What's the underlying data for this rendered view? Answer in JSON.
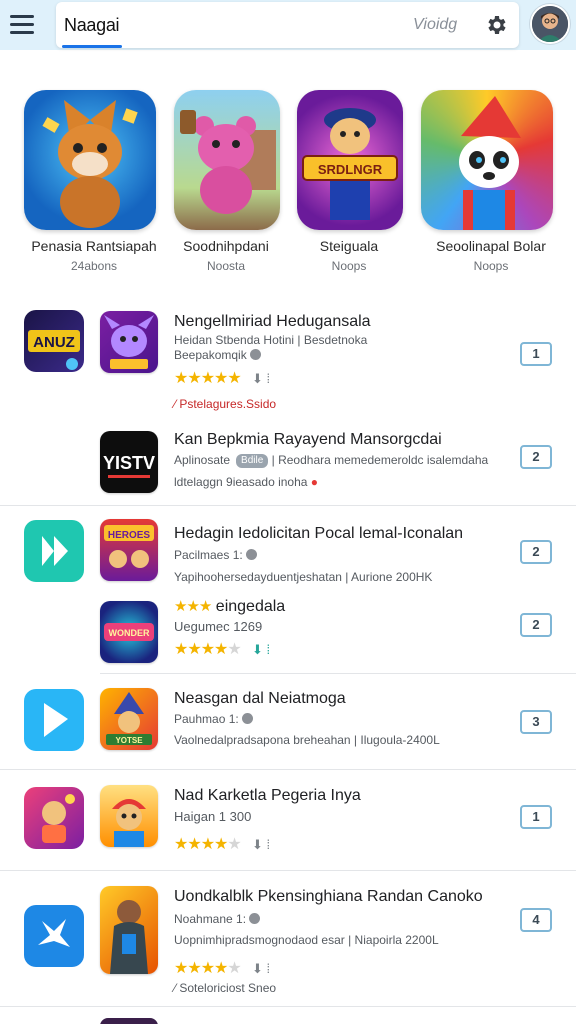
{
  "header": {
    "search_value": "Naagai",
    "search_hint": "Vioidg",
    "menu_icon": "hamburger-menu-icon",
    "settings_icon": "gear-icon",
    "avatar_icon": "user-avatar"
  },
  "featured": [
    {
      "title": "Penasia Rantsiapah",
      "subtitle": "24abons",
      "icon": "fox-hero-game-icon"
    },
    {
      "title": "Soodnihpdani",
      "subtitle": "Noosta",
      "icon": "pink-bear-game-icon"
    },
    {
      "title": "Steiguala",
      "subtitle": "Noops",
      "icon": "pirate-runner-game-icon",
      "badge_text": "SRDLNGR"
    },
    {
      "title": "Seoolinapal Bolar",
      "subtitle": "Noops",
      "icon": "panda-wizard-game-icon"
    }
  ],
  "list": [
    {
      "group_icon": "rushy-logo-icon",
      "group_icon_text": "ANUZ",
      "rows": [
        {
          "title": "Nengellmiriad Hedugansala",
          "line1": "Heidan Stbenda Hotini | Besdetnoka",
          "line2": "Beepakomqik",
          "stars": 5,
          "rank": "1",
          "note": "Pstelagures.Ssido",
          "icon": "purple-dragon-game-icon"
        },
        {
          "title": "Kan Bepkmia Rayayend Mansorgcdai",
          "line1": "Aplinosate",
          "tag": "Bdile",
          "line2": "| Reodhara memedemeroldc isalemdaha",
          "line3": "ldtelaggn 9ieasado inoha",
          "rank": "2",
          "icon_text": "YISTV",
          "icon": "tv-channel-app-icon"
        }
      ]
    },
    {
      "group_icon": "teal-play-icon",
      "rows": [
        {
          "title": "Hedagin Iedolicitan Pocal lemal-Iconalan",
          "line1": "Pacilmaes 1:",
          "line2": "Yapihoohersedayduentjeshatan | Aurione 200HK",
          "rank": "2",
          "icon_text": "HEROES",
          "icon": "heroes-party-game-icon"
        },
        {
          "title": "eingedala",
          "title_stars": 3,
          "line1": "Uegumec 1269",
          "stars": 4,
          "rank": "2",
          "icon_text": "WONDER",
          "icon": "neon-wonder-game-icon"
        }
      ]
    },
    {
      "group_icon": "blue-play-icon",
      "rows": [
        {
          "title": "Neasgan dal Neiatmoga",
          "line1": "Pauhmao 1:",
          "line2": "Vaolnedalpradsapona breheahan | Ilugoula-2400L",
          "rank": "3",
          "icon_text": "YOTSE",
          "icon": "wizard-hat-game-icon"
        }
      ]
    },
    {
      "group_icon": "pink-kid-game-icon",
      "rows": [
        {
          "title": "Nad Karketla Pegeria Inya",
          "line1": "Haigan 1 300",
          "stars": 4,
          "rank": "1",
          "icon": "red-cap-hero-game-icon"
        }
      ]
    },
    {
      "group_icon": "blue-rabbit-icon",
      "rows": [
        {
          "title": "Uondkalblk Pkensinghiana Randan Canoko",
          "line1": "Noahmane 1:",
          "line2": "Uopnimhipradsmognodaod esar | Niapoirla 2200L",
          "stars": 4,
          "note": "Soteloriciost Sneo",
          "rank": "4",
          "icon": "warrior-portrait-game-icon"
        }
      ]
    }
  ],
  "colors": {
    "header_bg": "#dff1fb",
    "accent": "#1a73e8",
    "star": "#f4b400",
    "rank_border": "#7fb6d6",
    "note_red": "#c62828"
  }
}
